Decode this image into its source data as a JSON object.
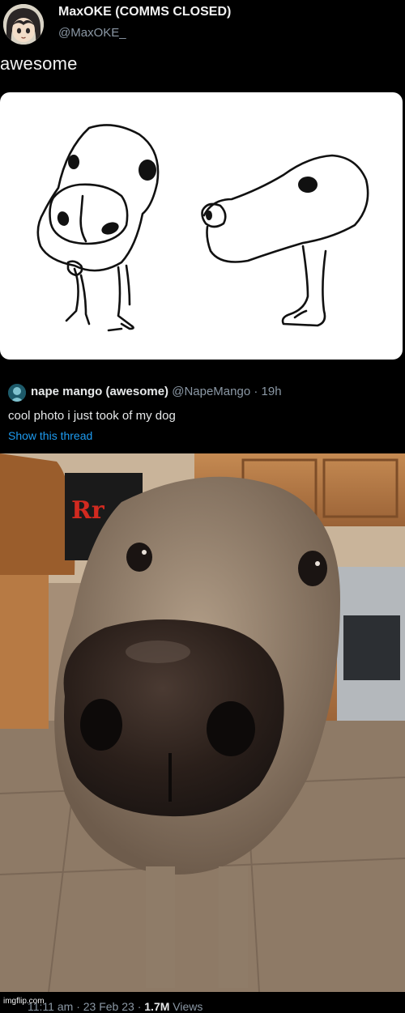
{
  "tweet": {
    "display_name": "MaxOKE (COMMS CLOSED)",
    "handle": "@MaxOKE_",
    "text": "awesome"
  },
  "quoted_tweet": {
    "display_name": "nape mango (awesome)",
    "handle": "@NapeMango",
    "separator": "·",
    "age": "19h",
    "text": "cool photo i just took of my dog",
    "show_thread_label": "Show this thread"
  },
  "photo": {
    "sign_text": "Rr"
  },
  "footer": {
    "time": "11:11 am",
    "separator": "·",
    "date": "23 Feb 23",
    "views_count": "1.7M",
    "views_label": "Views"
  },
  "watermark": "imgflip.com",
  "colors": {
    "background": "#000000",
    "accent_link": "#1d9bf0",
    "secondary_text": "#8b98a5"
  }
}
